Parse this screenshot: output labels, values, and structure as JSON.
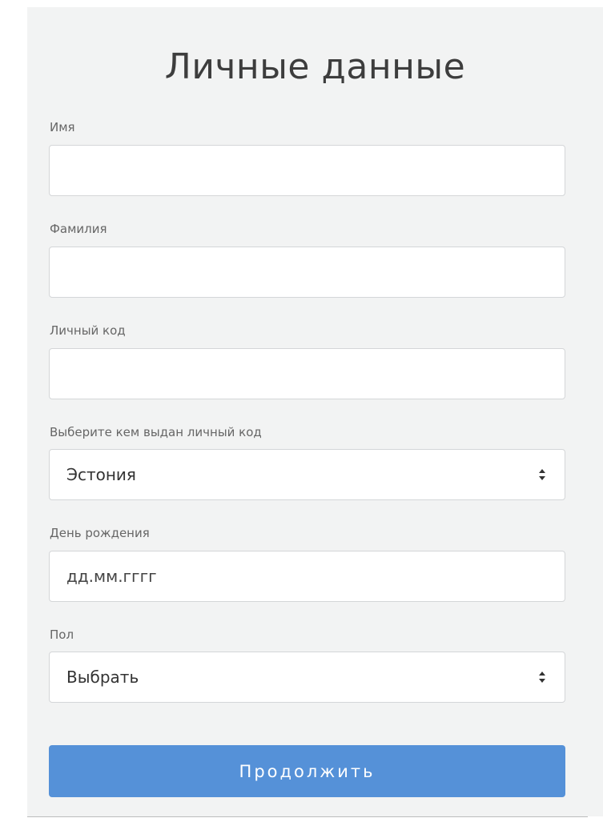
{
  "form": {
    "title": "Личные данные",
    "first_name": {
      "label": "Имя",
      "value": ""
    },
    "last_name": {
      "label": "Фамилия",
      "value": ""
    },
    "personal_code": {
      "label": "Личный код",
      "value": ""
    },
    "issuer": {
      "label": "Выберите кем выдан личный код",
      "selected": "Эстония"
    },
    "birthday": {
      "label": "День рождения",
      "placeholder": "дд.мм.гггг"
    },
    "gender": {
      "label": "Пол",
      "selected": "Выбрать"
    },
    "submit_label": "Продолжить"
  },
  "colors": {
    "panel_background": "#f2f3f3",
    "button": "#5591d8",
    "border": "#d4d6d8"
  }
}
